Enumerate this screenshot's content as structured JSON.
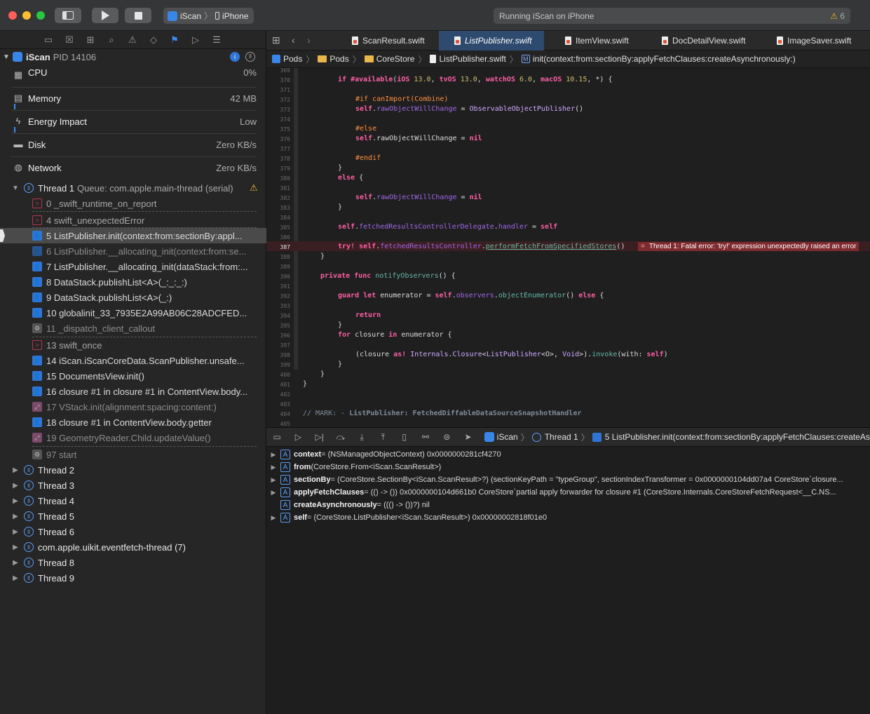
{
  "toolbar": {
    "scheme_app": "iScan",
    "scheme_device": "iPhone",
    "status_text": "Running iScan on iPhone",
    "warning_count": "6"
  },
  "process": {
    "name": "iScan",
    "pid": "PID 14106"
  },
  "gauges": [
    {
      "label": "CPU",
      "value": "0%"
    },
    {
      "label": "Memory",
      "value": "42 MB"
    },
    {
      "label": "Energy Impact",
      "value": "Low"
    },
    {
      "label": "Disk",
      "value": "Zero KB/s"
    },
    {
      "label": "Network",
      "value": "Zero KB/s"
    }
  ],
  "thread1": {
    "name": "Thread 1",
    "queue": "Queue: com.apple.main-thread (serial)"
  },
  "frames": [
    "0 _swift_runtime_on_report",
    "4 swift_unexpectedError",
    "5 ListPublisher.init(context:from:sectionBy:appl...",
    "6 ListPublisher.__allocating_init(context:from:se...",
    "7 ListPublisher.__allocating_init(dataStack:from:...",
    "8 DataStack.publishList<A>(_:_:_:)",
    "9 DataStack.publishList<A>(_:)",
    "10 globalinit_33_7935E2A99AB06C28ADCFED...",
    "11 _dispatch_client_callout",
    "13 swift_once",
    "14 iScan.iScanCoreData.ScanPublisher.unsafe...",
    "15 DocumentsView.init()",
    "16 closure #1 in closure #1 in ContentView.body...",
    "17 VStack.init(alignment:spacing:content:)",
    "18 closure #1 in ContentView.body.getter",
    "19 GeometryReader.Child.updateValue()",
    "97 start"
  ],
  "threads": [
    "Thread 2",
    "Thread 3",
    "Thread 4",
    "Thread 5",
    "Thread 6",
    "com.apple.uikit.eventfetch-thread (7)",
    "Thread 8",
    "Thread 9"
  ],
  "tabs": [
    "ScanResult.swift",
    "ListPublisher.swift",
    "ItemView.swift",
    "DocDetailView.swift",
    "ImageSaver.swift"
  ],
  "jumpbar": [
    "Pods",
    "Pods",
    "CoreStore",
    "ListPublisher.swift",
    "init(context:from:sectionBy:applyFetchClauses:createAsynchronously:)"
  ],
  "code": {
    "first_line": "369",
    "error_text": "Thread 1: Fatal error: 'try!' expression unexpectedly raised an error"
  },
  "debugbar": {
    "app": "iScan",
    "thread": "Thread 1",
    "frame": "5 ListPublisher.init(context:from:sectionBy:applyFetchClauses:createAs"
  },
  "variables": [
    {
      "name": "context",
      "value": " = (NSManagedObjectContext) 0x0000000281cf4270",
      "expandable": true
    },
    {
      "name": "from",
      "value": " (CoreStore.From<iScan.ScanResult>)",
      "expandable": true
    },
    {
      "name": "sectionBy",
      "value": " = (CoreStore.SectionBy<iScan.ScanResult>?) (sectionKeyPath = \"typeGroup\", sectionIndexTransformer = 0x0000000104dd07a4 CoreStore`closure...",
      "expandable": true
    },
    {
      "name": "applyFetchClauses",
      "value": " = (() -> ()) 0x0000000104d661b0 CoreStore`partial apply forwarder for closure #1 (CoreStore.Internals.CoreStoreFetchRequest<__C.NS...",
      "expandable": true
    },
    {
      "name": "createAsynchronously",
      "value": " = ((() -> ())?) nil",
      "expandable": false
    },
    {
      "name": "self",
      "value": " = (CoreStore.ListPublisher<iScan.ScanResult>) 0x00000002818f01e0",
      "expandable": true
    }
  ]
}
